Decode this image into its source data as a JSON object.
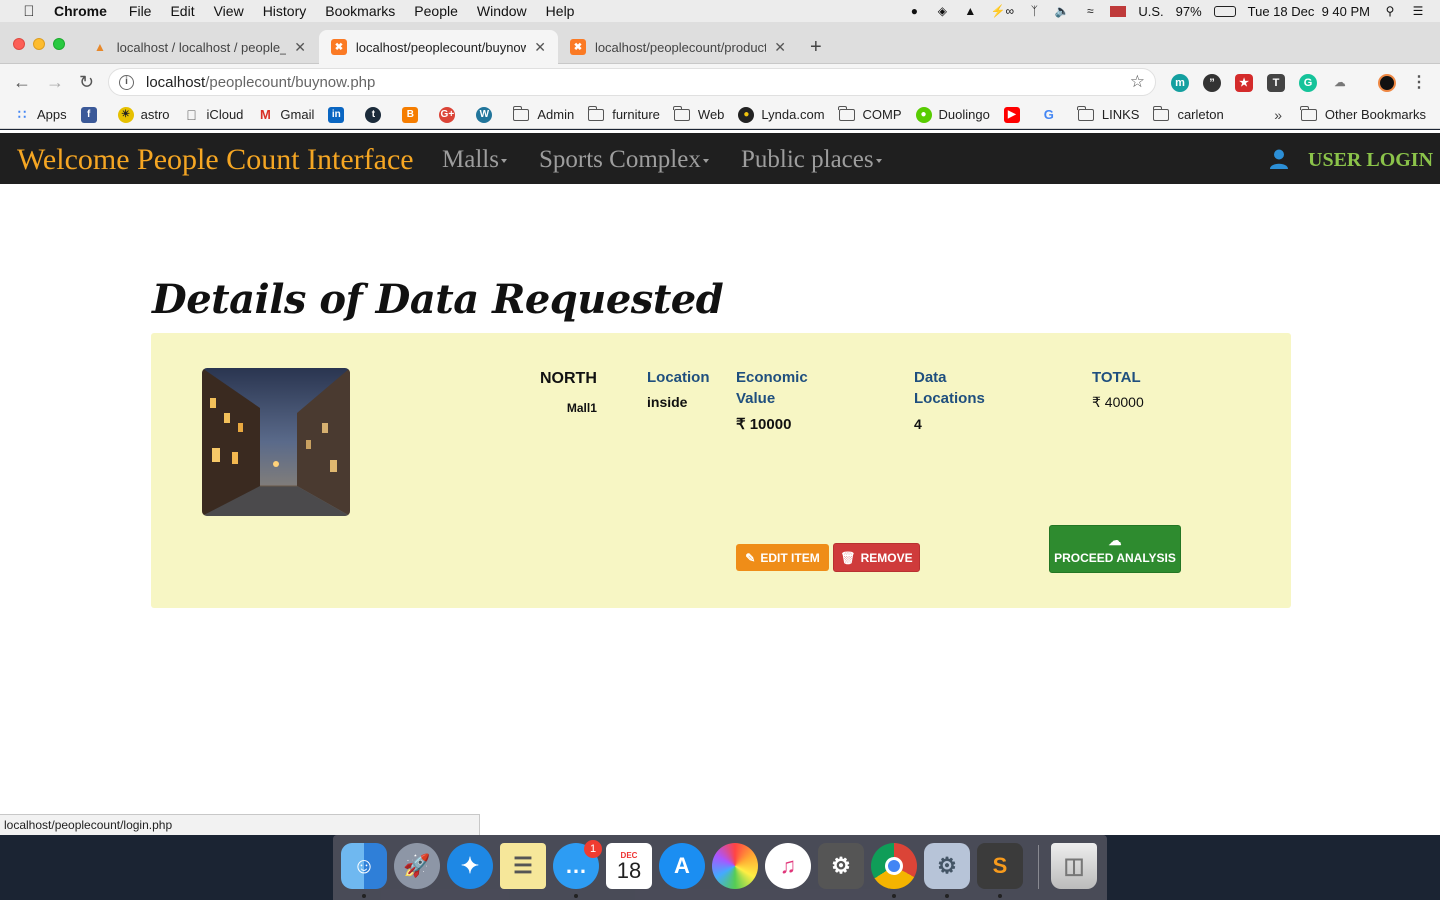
{
  "menubar": {
    "app": "Chrome",
    "items": [
      "File",
      "Edit",
      "View",
      "History",
      "Bookmarks",
      "People",
      "Window",
      "Help"
    ],
    "input_source": "U.S.",
    "battery": "97%",
    "datetime": "Tue 18 Dec  9 40 PM"
  },
  "tabs": [
    {
      "title": "localhost / localhost / people_c",
      "favicon": "phpmyadmin-icon"
    },
    {
      "title": "localhost/peoplecount/buynow.",
      "favicon": "xampp-icon"
    },
    {
      "title": "localhost/peoplecount/product",
      "favicon": "xampp-icon"
    }
  ],
  "address": {
    "host": "localhost",
    "path": "/peoplecount/buynow.php"
  },
  "bookmarks": [
    {
      "label": "Apps",
      "icon": "apps-grid-icon"
    },
    {
      "label": "",
      "icon": "facebook-icon"
    },
    {
      "label": "astro",
      "icon": "astro-icon"
    },
    {
      "label": "iCloud",
      "icon": "apple-icon"
    },
    {
      "label": "Gmail",
      "icon": "gmail-icon"
    },
    {
      "label": "",
      "icon": "linkedin-icon"
    },
    {
      "label": "",
      "icon": "tumblr-icon"
    },
    {
      "label": "",
      "icon": "blogger-icon"
    },
    {
      "label": "",
      "icon": "google-plus-icon"
    },
    {
      "label": "",
      "icon": "wordpress-icon"
    },
    {
      "label": "Admin",
      "icon": "folder-icon"
    },
    {
      "label": "furniture",
      "icon": "folder-icon"
    },
    {
      "label": "Web",
      "icon": "folder-icon"
    },
    {
      "label": "Lynda.com",
      "icon": "lynda-icon"
    },
    {
      "label": "COMP",
      "icon": "folder-icon"
    },
    {
      "label": "Duolingo",
      "icon": "duolingo-icon"
    },
    {
      "label": "",
      "icon": "youtube-icon"
    },
    {
      "label": "",
      "icon": "google-icon"
    },
    {
      "label": "LINKS",
      "icon": "folder-icon"
    },
    {
      "label": "carleton",
      "icon": "folder-icon"
    }
  ],
  "other_bookmarks": "Other Bookmarks",
  "site": {
    "brand": "Welcome People Count Interface",
    "nav": [
      "Malls",
      "Sports Complex",
      "Public places"
    ],
    "user_login": "USER LOGIN"
  },
  "page": {
    "title": "Details of Data Requested",
    "region": "NORTH",
    "place": "Mall1",
    "location_label": "Location",
    "location_value": "inside",
    "economic_label_1": "Economic",
    "economic_label_2": "Value",
    "economic_value": "₹ 10000",
    "data_label_1": "Data",
    "data_label_2": "Locations",
    "data_value": "4",
    "total_label": "TOTAL",
    "total_value": "₹ 40000",
    "edit_label": "EDIT ITEM",
    "remove_label": "REMOVE",
    "proceed_label": "PROCEED ANALYSIS"
  },
  "statusbar": "localhost/peoplecount/login.php",
  "dock": {
    "messages_badge": "1",
    "calendar_month": "DEC",
    "calendar_day": "18"
  },
  "colors": {
    "brand": "#f5a623",
    "user_login": "#8bc34a",
    "card_bg": "#f7f6c4",
    "heading_blue": "#1f4f7e",
    "edit": "#ef8d18",
    "remove": "#cf3b3b",
    "proceed": "#2e8b2f"
  }
}
